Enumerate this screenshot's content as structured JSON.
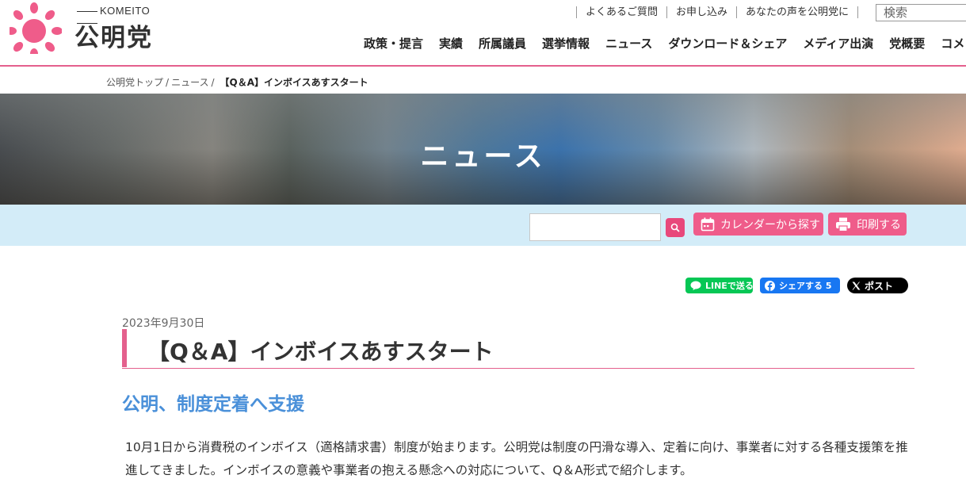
{
  "logo": {
    "en": "KOMEITO",
    "jp": "公明党"
  },
  "util_nav": [
    "よくあるご質問",
    "お申し込み",
    "あなたの声を公明党に"
  ],
  "search_top": {
    "placeholder": "検索"
  },
  "main_nav": [
    "政策・提言",
    "実績",
    "所属議員",
    "選挙情報",
    "ニュース",
    "ダウンロード＆シェア",
    "メディア出演",
    "党概要",
    "コメ"
  ],
  "breadcrumb": {
    "home": "公明党トップ",
    "sep": "/",
    "section": "ニュース",
    "current": "【Q＆A】インボイスあすスタート"
  },
  "hero": {
    "title": "ニュース"
  },
  "toolbar": {
    "calendar_label": "カレンダーから探す",
    "print_label": "印刷する"
  },
  "social": {
    "line_label": "LINEで送る",
    "fb_label": "シェアする",
    "fb_count": "5",
    "x_label": "ポスト"
  },
  "article": {
    "date": "2023年9月30日",
    "title": "【Q＆A】インボイスあすスタート",
    "subtitle": "公明、制度定着へ支援",
    "body": "10月1日から消費税のインボイス（適格請求書）制度が始まります。公明党は制度の円滑な導入、定着に向け、事業者に対する各種支援策を推進してきました。インボイスの意義や事業者の抱える懸念への対応について、Q＆A形式で紹介します。"
  },
  "colors": {
    "accent": "#e4608d",
    "button": "#ef5c8a",
    "toolbar_bg": "#d3ecf8",
    "subtitle": "#4a90d9",
    "line": "#06c755",
    "facebook": "#1877f2"
  }
}
